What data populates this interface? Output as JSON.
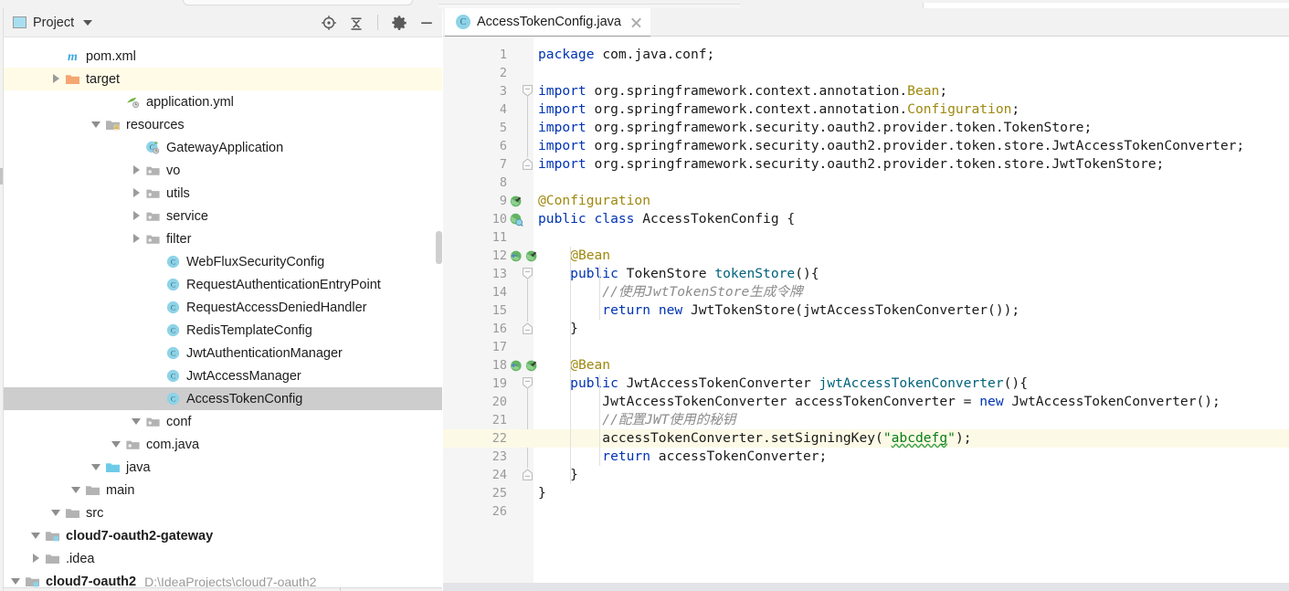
{
  "tool_window": {
    "title": "Project",
    "icon": "project-icon",
    "actions": [
      {
        "name": "locate-icon",
        "label": "Select Opened File"
      },
      {
        "name": "collapse-all-icon",
        "label": "Collapse All"
      },
      {
        "name": "gear-icon",
        "label": "Settings"
      },
      {
        "name": "minimize-icon",
        "label": "Hide"
      }
    ]
  },
  "tree": [
    {
      "label": "cloud7-oauth2",
      "path": "D:\\IdeaProjects\\cloud7-oauth2",
      "depth": 0,
      "twisty": "open",
      "icon": "module-folder-icon",
      "bold": true,
      "state": "normal"
    },
    {
      "label": ".idea",
      "path": "",
      "depth": 1,
      "twisty": "closed",
      "icon": "folder-icon",
      "bold": false,
      "state": "normal"
    },
    {
      "label": "cloud7-oauth2-gateway",
      "path": "",
      "depth": 1,
      "twisty": "open",
      "icon": "module-folder-icon",
      "bold": true,
      "state": "normal"
    },
    {
      "label": "src",
      "path": "",
      "depth": 2,
      "twisty": "open",
      "icon": "folder-icon",
      "bold": false,
      "state": "normal"
    },
    {
      "label": "main",
      "path": "",
      "depth": 3,
      "twisty": "open",
      "icon": "folder-icon",
      "bold": false,
      "state": "normal"
    },
    {
      "label": "java",
      "path": "",
      "depth": 4,
      "twisty": "open",
      "icon": "source-folder-icon",
      "bold": false,
      "state": "normal"
    },
    {
      "label": "com.java",
      "path": "",
      "depth": 5,
      "twisty": "open",
      "icon": "package-icon",
      "bold": false,
      "state": "normal"
    },
    {
      "label": "conf",
      "path": "",
      "depth": 6,
      "twisty": "open",
      "icon": "package-icon",
      "bold": false,
      "state": "normal"
    },
    {
      "label": "AccessTokenConfig",
      "path": "",
      "depth": 7,
      "twisty": "none",
      "icon": "java-class-icon",
      "bold": false,
      "state": "selected"
    },
    {
      "label": "JwtAccessManager",
      "path": "",
      "depth": 7,
      "twisty": "none",
      "icon": "java-class-icon",
      "bold": false,
      "state": "normal"
    },
    {
      "label": "JwtAuthenticationManager",
      "path": "",
      "depth": 7,
      "twisty": "none",
      "icon": "java-class-icon",
      "bold": false,
      "state": "normal"
    },
    {
      "label": "RedisTemplateConfig",
      "path": "",
      "depth": 7,
      "twisty": "none",
      "icon": "java-class-icon",
      "bold": false,
      "state": "normal"
    },
    {
      "label": "RequestAccessDeniedHandler",
      "path": "",
      "depth": 7,
      "twisty": "none",
      "icon": "java-class-icon",
      "bold": false,
      "state": "normal"
    },
    {
      "label": "RequestAuthenticationEntryPoint",
      "path": "",
      "depth": 7,
      "twisty": "none",
      "icon": "java-class-icon",
      "bold": false,
      "state": "normal"
    },
    {
      "label": "WebFluxSecurityConfig",
      "path": "",
      "depth": 7,
      "twisty": "none",
      "icon": "java-class-icon",
      "bold": false,
      "state": "normal"
    },
    {
      "label": "filter",
      "path": "",
      "depth": 6,
      "twisty": "closed",
      "icon": "package-icon",
      "bold": false,
      "state": "normal"
    },
    {
      "label": "service",
      "path": "",
      "depth": 6,
      "twisty": "closed",
      "icon": "package-icon",
      "bold": false,
      "state": "normal"
    },
    {
      "label": "utils",
      "path": "",
      "depth": 6,
      "twisty": "closed",
      "icon": "package-icon",
      "bold": false,
      "state": "normal"
    },
    {
      "label": "vo",
      "path": "",
      "depth": 6,
      "twisty": "closed",
      "icon": "package-icon",
      "bold": false,
      "state": "normal"
    },
    {
      "label": "GatewayApplication",
      "path": "",
      "depth": 6,
      "twisty": "none",
      "icon": "spring-class-icon",
      "bold": false,
      "state": "normal"
    },
    {
      "label": "resources",
      "path": "",
      "depth": 4,
      "twisty": "open",
      "icon": "resources-folder-icon",
      "bold": false,
      "state": "normal"
    },
    {
      "label": "application.yml",
      "path": "",
      "depth": 5,
      "twisty": "none",
      "icon": "spring-yaml-icon",
      "bold": false,
      "state": "normal"
    },
    {
      "label": "target",
      "path": "",
      "depth": 2,
      "twisty": "closed",
      "icon": "excluded-folder-icon",
      "bold": false,
      "state": "excluded"
    },
    {
      "label": "pom.xml",
      "path": "",
      "depth": 2,
      "twisty": "none",
      "icon": "maven-icon",
      "bold": false,
      "state": "normal"
    }
  ],
  "editor": {
    "tab": {
      "label": "AccessTokenConfig.java",
      "icon": "java-class-icon",
      "close": "close-icon"
    },
    "current_line": 22,
    "lines": [
      {
        "n": 1,
        "gutter": [],
        "fold": "none"
      },
      {
        "n": 2,
        "gutter": [],
        "fold": "none"
      },
      {
        "n": 3,
        "gutter": [],
        "fold": "start"
      },
      {
        "n": 4,
        "gutter": [],
        "fold": "body"
      },
      {
        "n": 5,
        "gutter": [],
        "fold": "body"
      },
      {
        "n": 6,
        "gutter": [],
        "fold": "body"
      },
      {
        "n": 7,
        "gutter": [],
        "fold": "end"
      },
      {
        "n": 8,
        "gutter": [],
        "fold": "none"
      },
      {
        "n": 9,
        "gutter": [
          "bean-check-icon"
        ],
        "fold": "none"
      },
      {
        "n": 10,
        "gutter": [
          "spring-bean-icon"
        ],
        "fold": "none"
      },
      {
        "n": 11,
        "gutter": [],
        "fold": "none"
      },
      {
        "n": 12,
        "gutter": [
          "bean-arrow-icon",
          "bean-check-icon"
        ],
        "fold": "none"
      },
      {
        "n": 13,
        "gutter": [],
        "fold": "start"
      },
      {
        "n": 14,
        "gutter": [],
        "fold": "body"
      },
      {
        "n": 15,
        "gutter": [],
        "fold": "body"
      },
      {
        "n": 16,
        "gutter": [],
        "fold": "end"
      },
      {
        "n": 17,
        "gutter": [],
        "fold": "none"
      },
      {
        "n": 18,
        "gutter": [
          "bean-arrow-icon",
          "bean-check-icon"
        ],
        "fold": "none"
      },
      {
        "n": 19,
        "gutter": [],
        "fold": "start"
      },
      {
        "n": 20,
        "gutter": [],
        "fold": "body"
      },
      {
        "n": 21,
        "gutter": [],
        "fold": "body"
      },
      {
        "n": 22,
        "gutter": [],
        "fold": "body"
      },
      {
        "n": 23,
        "gutter": [],
        "fold": "body"
      },
      {
        "n": 24,
        "gutter": [],
        "fold": "end"
      },
      {
        "n": 25,
        "gutter": [],
        "fold": "none"
      },
      {
        "n": 26,
        "gutter": [],
        "fold": "none"
      }
    ],
    "code": {
      "l1": "package com.java.conf;",
      "l3a": "import",
      "l3b": " org.springframework.context.annotation.",
      "l3c": "Bean",
      "l3d": ";",
      "l4a": "import",
      "l4b": " org.springframework.context.annotation.",
      "l4c": "Configuration",
      "l4d": ";",
      "l5a": "import",
      "l5b": " org.springframework.security.oauth2.provider.token.TokenStore;",
      "l6a": "import",
      "l6b": " org.springframework.security.oauth2.provider.token.store.JwtAccessTokenConverter;",
      "l7a": "import",
      "l7b": " org.springframework.security.oauth2.provider.token.store.JwtTokenStore;",
      "l9": "@Configuration",
      "l10a": "public",
      "l10b": " ",
      "l10c": "class",
      "l10d": " AccessTokenConfig {",
      "l12": "@Bean",
      "l13a": "public",
      "l13b": " TokenStore ",
      "l13c": "tokenStore",
      "l13d": "(){",
      "l14": "//使用JwtTokenStore生成令牌",
      "l15a": "return",
      "l15b": " ",
      "l15c": "new",
      "l15d": " JwtTokenStore(jwtAccessTokenConverter());",
      "l16": "}",
      "l18": "@Bean",
      "l19a": "public",
      "l19b": " JwtAccessTokenConverter ",
      "l19c": "jwtAccessTokenConverter",
      "l19d": "(){",
      "l20a": "JwtAccessTokenConverter accessTokenConverter = ",
      "l20b": "new",
      "l20c": " JwtAccessTokenConverter();",
      "l21": "//配置JWT使用的秘钥",
      "l22a": "accessTokenConverter.setSigningKey(",
      "l22b": "\"",
      "l22c": "abcdefg",
      "l22d": "\"",
      "l22e": ");",
      "l23a": "return",
      "l23b": " accessTokenConverter;",
      "l24": "}",
      "l25": "}"
    }
  },
  "colors": {
    "keyword": "#0033b3",
    "annotation": "#9e880d",
    "string": "#067d17",
    "comment": "#8c8c8c",
    "method": "#00627a",
    "selection": "#cdcdcd",
    "excluded_row": "#fffbe6",
    "current_line": "#fcfae6"
  }
}
